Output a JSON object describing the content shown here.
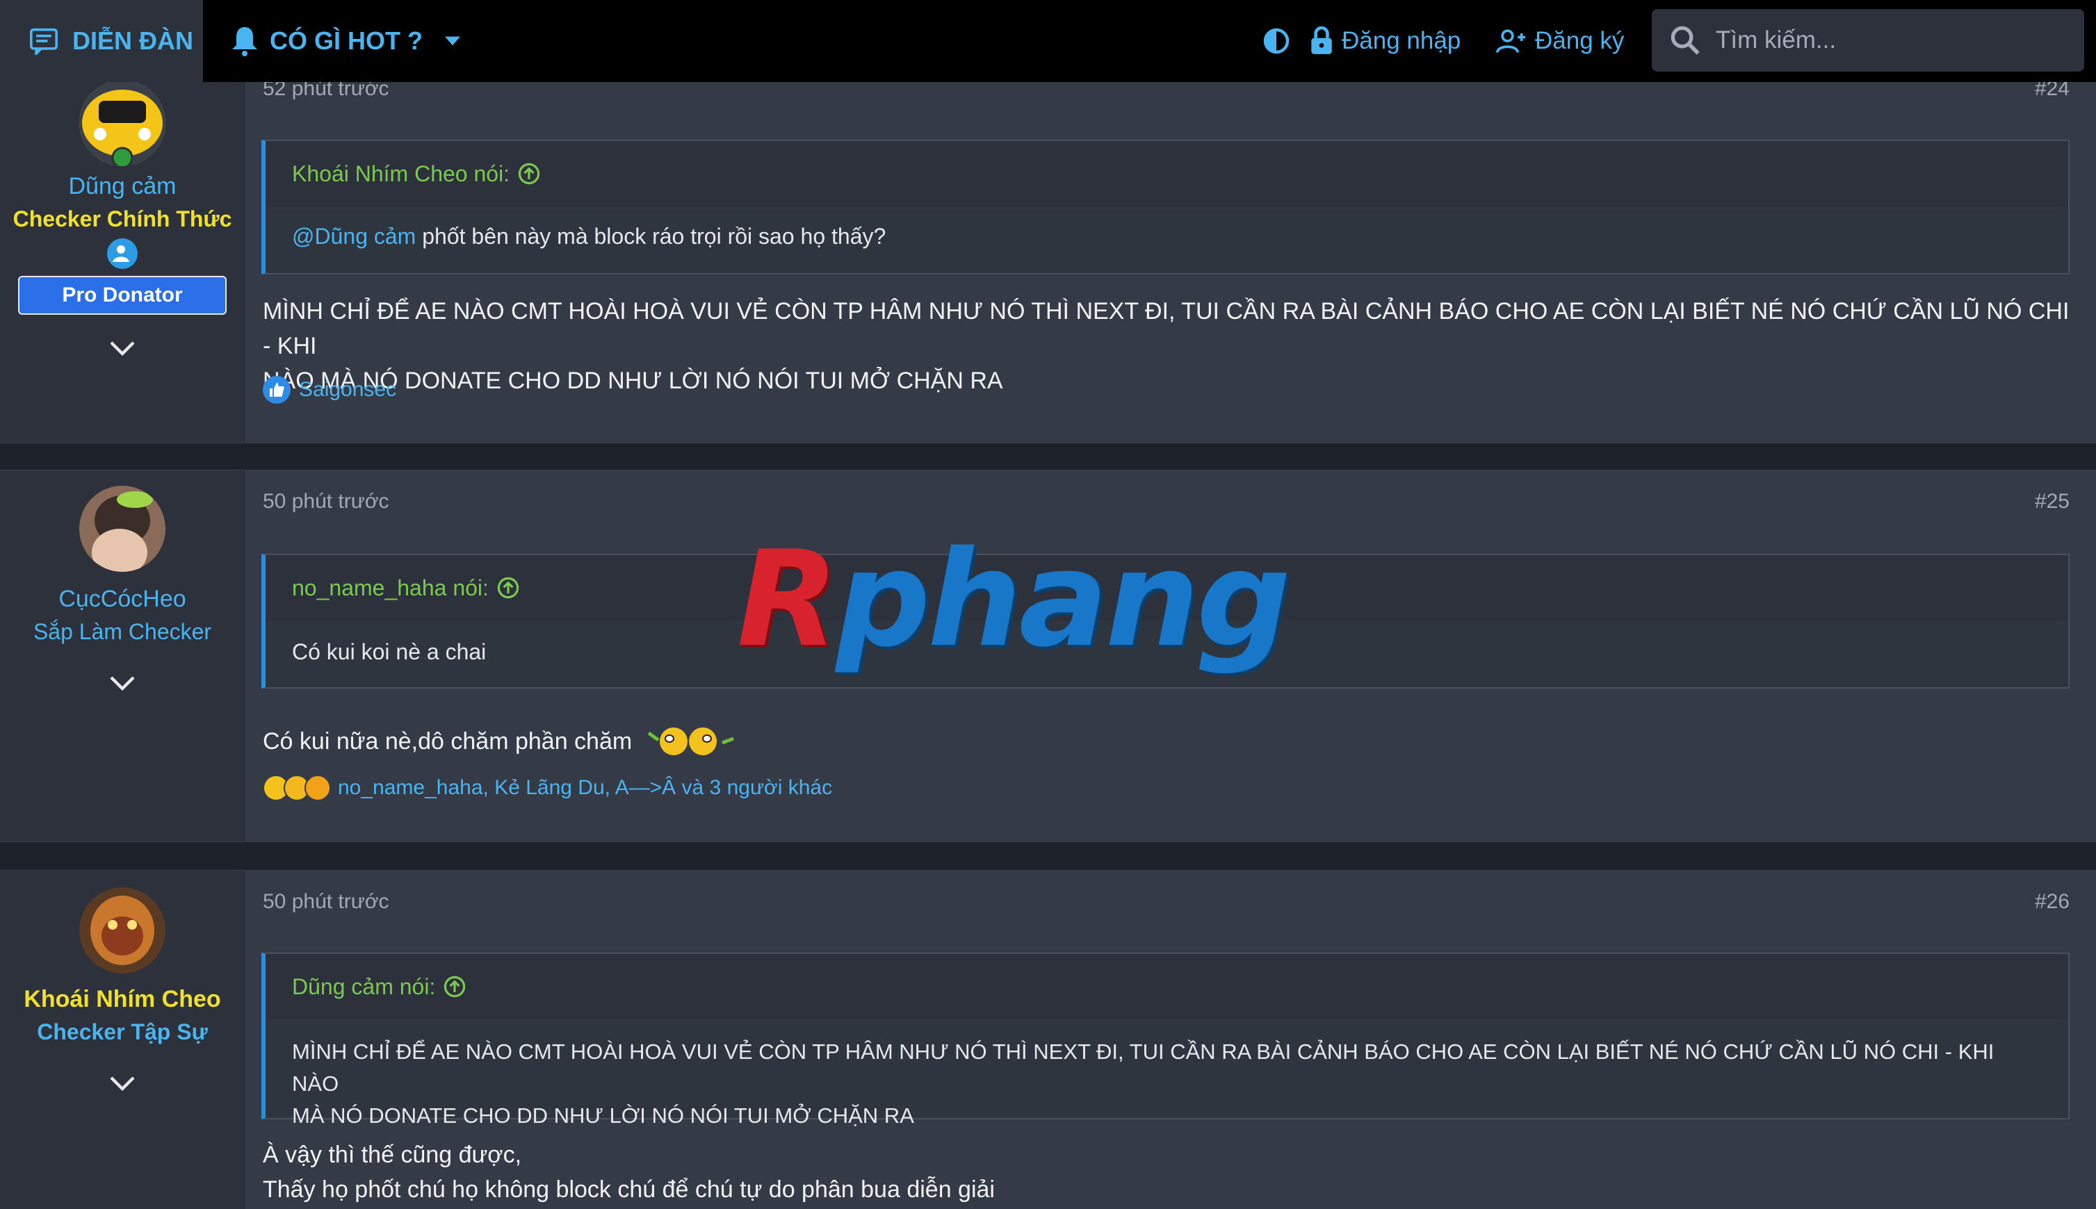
{
  "nav": {
    "forum_label": "DIỄN ĐÀN",
    "hot_label": "CÓ GÌ HOT ?",
    "login_label": "Đăng nhập",
    "register_label": "Đăng ký",
    "search_placeholder": "Tìm kiếm..."
  },
  "posts": [
    {
      "time": "52 phút trước",
      "number": "#24",
      "username": "Dũng cảm",
      "user_title": "Checker Chính Thức",
      "badge": "Pro Donator",
      "quote_author": "Khoái Nhím Cheo nói:",
      "quote_mention": "@Dũng cảm",
      "quote_text": " phốt bên này mà block ráo trọi rồi sao họ thấy?",
      "body_line1": "MÌNH CHỈ ĐỂ AE NÀO CMT HOÀI HOÀ VUI VẺ CÒN TP HÂM NHƯ NÓ THÌ NEXT ĐI, TUI CẦN RA BÀI CẢNH BÁO CHO AE CÒN LẠI BIẾT NÉ NÓ CHỨ CẦN LŨ NÓ CHI - KHI",
      "body_line2": "NÀO MÀ NÓ DONATE CHO DD NHƯ LỜI NÓ NÓI TUI MỞ CHẶN RA",
      "reactions": "Saigonsec"
    },
    {
      "time": "50 phút trước",
      "number": "#25",
      "username": "CụcCócHeo",
      "user_title": "Sắp Làm Checker",
      "quote_author": "no_name_haha nói:",
      "quote_text": "Có kui koi nè a chai",
      "body_line1": "Có kui nữa nè,dô chăm phần chăm",
      "reactions": "no_name_haha, Kẻ Lãng Du, A—>Â và 3 người khác"
    },
    {
      "time": "50 phút trước",
      "number": "#26",
      "username": "Khoái Nhím Cheo",
      "user_title": "Checker Tập Sự",
      "quote_author": "Dũng cảm nói:",
      "quote_line1": "MÌNH CHỈ ĐỂ AE NÀO CMT HOÀI HOÀ VUI VẺ CÒN TP HÂM NHƯ NÓ THÌ NEXT ĐI, TUI CẦN RA BÀI CẢNH BÁO CHO AE CÒN LẠI BIẾT NÉ NÓ CHỨ CẦN LŨ NÓ CHI - KHI NÀO",
      "quote_line2": "MÀ NÓ DONATE CHO DD NHƯ LỜI NÓ NÓI TUI MỞ CHẶN RA",
      "body_line1": "À vậy thì thế cũng được,",
      "body_line2": "Thấy họ phốt chú họ không block chú để chú tự do phân bua diễn giải"
    }
  ],
  "watermark": {
    "first": "R",
    "rest": "phang"
  },
  "colors": {
    "accent_blue": "#4ab4f0",
    "quote_green": "#7bc94e",
    "title_yellow": "#f2e12a",
    "badge_blue": "#2a6ee8"
  }
}
